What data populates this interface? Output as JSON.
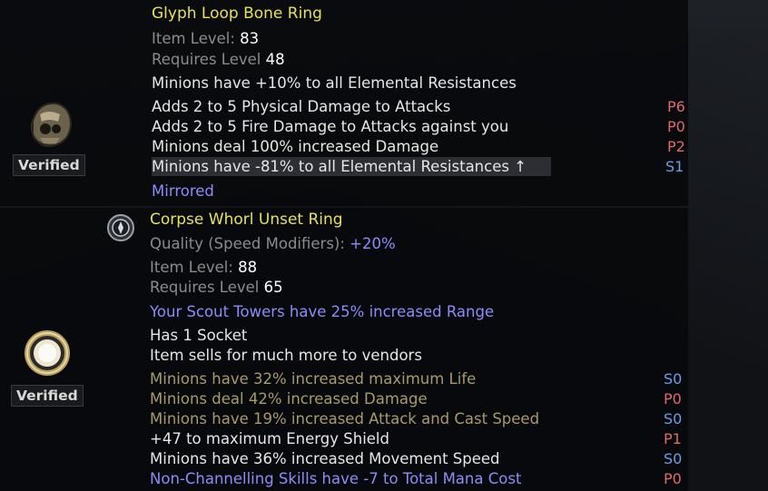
{
  "items": [
    {
      "name": "Glyph Loop Bone Ring",
      "item_level_label": "Item Level:",
      "item_level": "83",
      "requires_label": "Requires Level",
      "requires_level": "48",
      "implicit": "Minions have +10% to all Elemental Resistances",
      "mods": [
        {
          "text": "Adds 2 to 5 Physical Damage to Attacks",
          "tier": "P6"
        },
        {
          "text": "Adds 2 to 5 Fire Damage to Attacks against you",
          "tier": "P0"
        },
        {
          "text": "Minions deal 100% increased Damage",
          "tier": "P2"
        },
        {
          "text": "Minions have -81% to all Elemental Resistances ↑",
          "tier": "S1"
        }
      ],
      "footer": "Mirrored",
      "badge": "Verified",
      "icon": "bone-ring-icon"
    },
    {
      "name": "Corpse Whorl Unset Ring",
      "quality_label": "Quality (Speed Modifiers):",
      "quality": "+20%",
      "item_level_label": "Item Level:",
      "item_level": "88",
      "requires_label": "Requires Level",
      "requires_level": "65",
      "enchant": "Your Scout Towers have 25% increased Range",
      "implicits": [
        "Has 1 Socket",
        "Item sells for much more to vendors"
      ],
      "mods": [
        {
          "text": "Minions have 32% increased maximum Life",
          "tier": "S0"
        },
        {
          "text": "Minions deal 42% increased Damage",
          "tier": "P0"
        },
        {
          "text": "Minions have 19% increased Attack and Cast Speed",
          "tier": "S0"
        },
        {
          "text": "+47 to maximum Energy Shield",
          "tier": "P1"
        },
        {
          "text": "Minions have 36% increased Movement Speed",
          "tier": "S0"
        },
        {
          "text": "Non-Channelling Skills have -7 to Total Mana Cost",
          "tier": "P0"
        }
      ],
      "badge": "Verified",
      "icon": "unset-ring-icon",
      "influence_icon": "influence-emblem-icon"
    }
  ],
  "colors": {
    "title": "#e6e15a",
    "label_grey": "#8b8b8b",
    "magic_blue": "#8c8cfa",
    "crafted_tan": "#a89a6a",
    "tier_red": "#e06a6a",
    "tier_blue": "#6a9ee8"
  }
}
